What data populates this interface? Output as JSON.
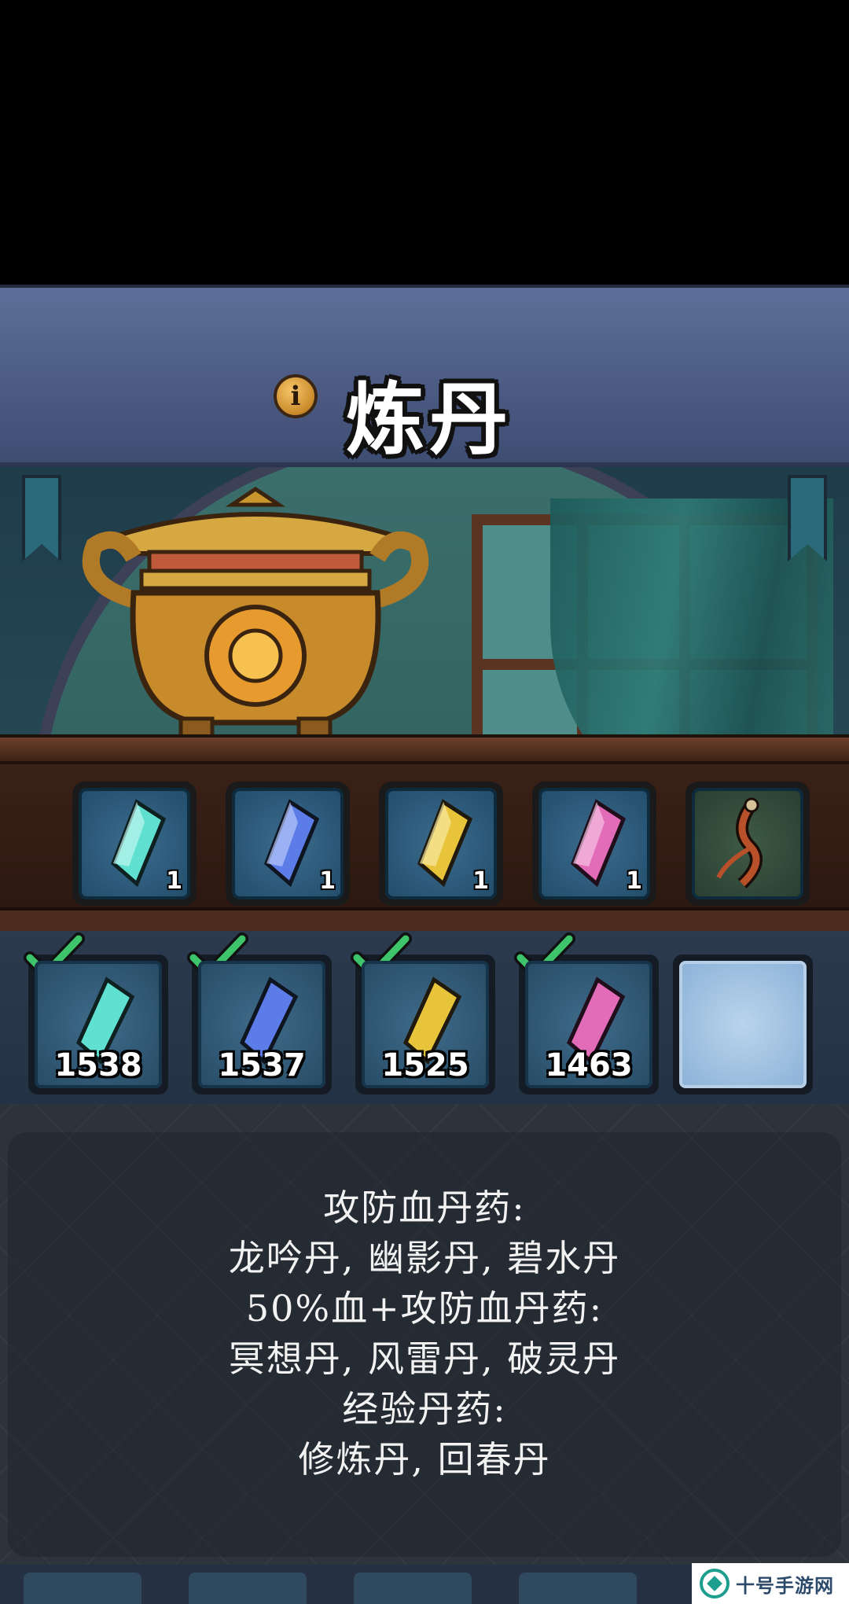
{
  "header": {
    "title": "炼丹",
    "info_glyph": "i"
  },
  "furnace_slots": [
    {
      "icon": "cyan-crystal-icon",
      "count": "1",
      "color": "#5fe0d0"
    },
    {
      "icon": "blue-crystal-icon",
      "count": "1",
      "color": "#5c7de8"
    },
    {
      "icon": "yellow-crystal-icon",
      "count": "1",
      "color": "#e7c43a"
    },
    {
      "icon": "pink-crystal-icon",
      "count": "1",
      "color": "#e26cb8"
    },
    {
      "icon": "ginseng-root-icon",
      "count": "",
      "color": "#b8502a"
    }
  ],
  "inventory": [
    {
      "icon": "cyan-crystal-icon",
      "qty": "1538",
      "checked": true,
      "color": "#5fe0d0"
    },
    {
      "icon": "blue-crystal-icon",
      "qty": "1537",
      "checked": true,
      "color": "#5c7de8"
    },
    {
      "icon": "yellow-crystal-icon",
      "qty": "1525",
      "checked": true,
      "color": "#e7c43a"
    },
    {
      "icon": "pink-crystal-icon",
      "qty": "1463",
      "checked": true,
      "color": "#e26cb8"
    }
  ],
  "info_panel": {
    "lines": [
      "攻防血丹药:",
      "龙吟丹, 幽影丹, 碧水丹",
      "50%血+攻防血丹药:",
      "冥想丹, 风雷丹, 破灵丹",
      "经验丹药:",
      "修炼丹, 回春丹"
    ]
  },
  "watermark": {
    "text": "十号手游网"
  },
  "colors": {
    "banner": "#4a5a82",
    "check": "#3ec46a",
    "overlay": "#2d333b"
  }
}
